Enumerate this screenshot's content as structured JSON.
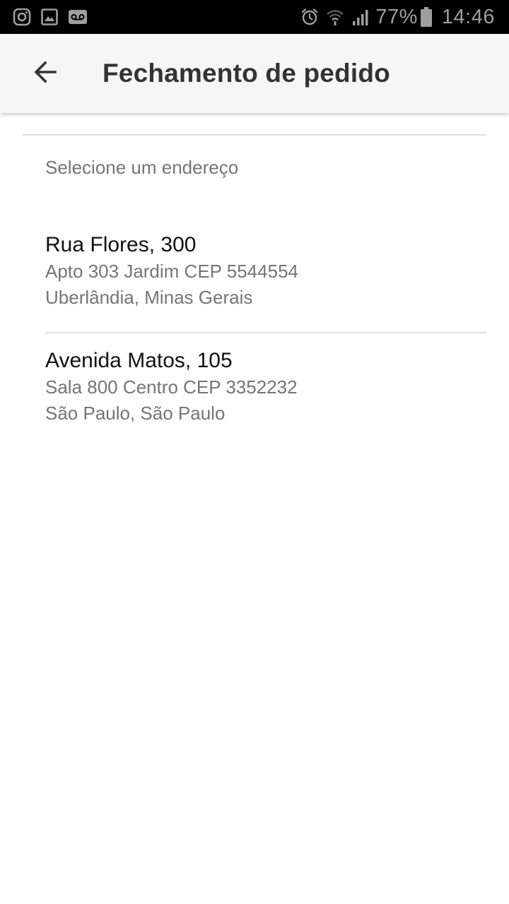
{
  "status_bar": {
    "icons_left": [
      "instagram-icon",
      "gallery-icon",
      "voicemail-icon"
    ],
    "icons_right": [
      "alarm-icon",
      "wifi-icon",
      "signal-icon"
    ],
    "battery": "77%",
    "time": "14:46"
  },
  "app_bar": {
    "back_icon": "arrow-back-icon",
    "title": "Fechamento de pedido"
  },
  "section_label": "Selecione um endereço",
  "addresses": [
    {
      "street": "Rua Flores, 300",
      "line2": "Apto 303 Jardim CEP 5544554",
      "line3": "Uberlândia, Minas Gerais"
    },
    {
      "street": "Avenida Matos, 105",
      "line2": "Sala 800 Centro CEP 3352232",
      "line3": "São Paulo, São Paulo"
    }
  ]
}
